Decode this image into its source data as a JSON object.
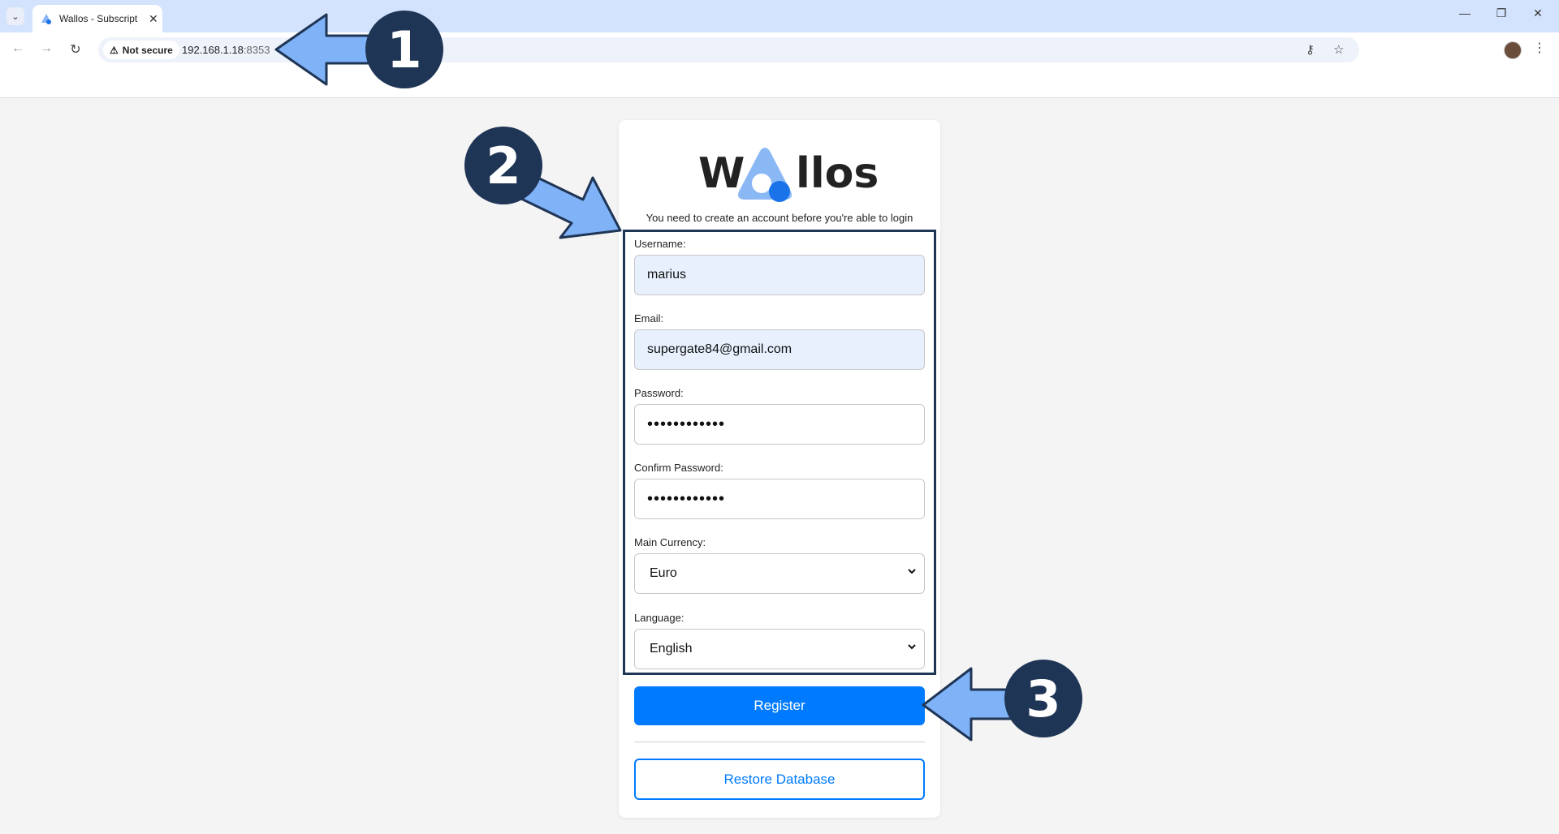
{
  "browser": {
    "tab_title": "Wallos - Subscript",
    "security_label": "Not secure",
    "url_host": "192.168.1.18",
    "url_port": ":8353"
  },
  "page": {
    "logo_left": "W",
    "logo_right": "llos",
    "subtitle": "You need to create an account before you're able to login",
    "form": {
      "username_label": "Username:",
      "username_value": "marius",
      "email_label": "Email:",
      "email_value": "supergate84@gmail.com",
      "password_label": "Password:",
      "password_value": "••••••••••••",
      "confirm_label": "Confirm Password:",
      "confirm_value": "••••••••••••",
      "currency_label": "Main Currency:",
      "currency_value": "Euro",
      "language_label": "Language:",
      "language_value": "English"
    },
    "register_label": "Register",
    "restore_label": "Restore Database"
  },
  "annotations": {
    "step1": "1",
    "step2": "2",
    "step3": "3"
  },
  "colors": {
    "accent": "#007bff",
    "callout": "#1f3556",
    "arrow": "#7fb2f6",
    "autofill": "#e8f0fe"
  }
}
